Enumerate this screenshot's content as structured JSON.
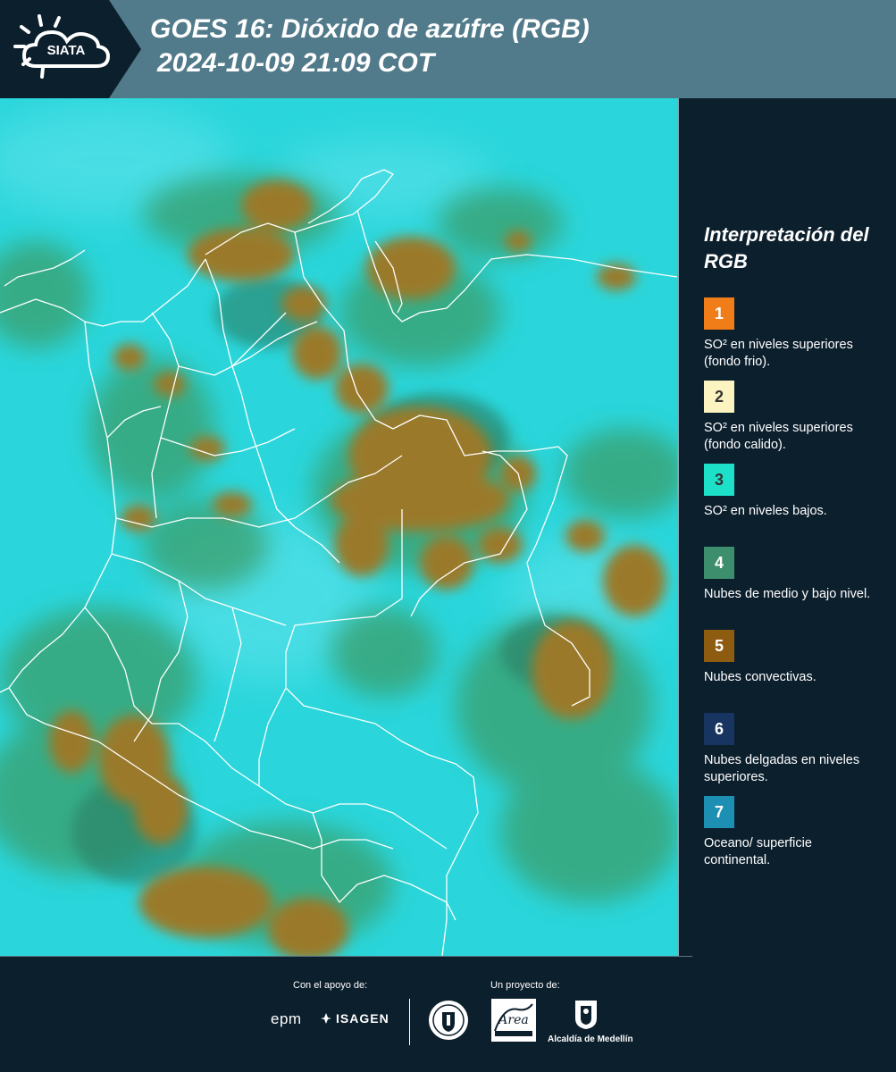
{
  "header": {
    "logo_text": "SIATA",
    "title_line1": "GOES 16: Dióxido de azúfre (RGB)",
    "title_line2": "2024-10-09 21:09 COT"
  },
  "legend": {
    "title": "Interpretación del RGB",
    "items": [
      {
        "number": "1",
        "color": "#f07d18",
        "text": "SO² en niveles superiores (fondo frio)."
      },
      {
        "number": "2",
        "color": "#fbf3c0",
        "text": "SO² en niveles superiores (fondo calido)."
      },
      {
        "number": "3",
        "color": "#1de0c9",
        "text": "SO² en niveles bajos."
      },
      {
        "number": "4",
        "color": "#3c8e6c",
        "text": "Nubes de medio y bajo nivel."
      },
      {
        "number": "5",
        "color": "#8e5c11",
        "text": "Nubes convectivas."
      },
      {
        "number": "6",
        "color": "#173560",
        "text": "Nubes delgadas en niveles superiores."
      },
      {
        "number": "7",
        "color": "#1d8fb3",
        "text": "Oceano/ superficie continental."
      }
    ]
  },
  "footer": {
    "support_label": "Con el apoyo de:",
    "project_label": "Un proyecto de:",
    "epm": "epm",
    "isagen": "ISAGEN",
    "area_logo_text": "Área Metropolitana Valle de Aburrá",
    "alcaldia": "Alcaldía de Medellín"
  },
  "map": {
    "background_color": "#2ad6db",
    "convective_color": "#9a7a2a",
    "mid_level_color": "#3a9e6a",
    "border_color": "#ffffff"
  }
}
